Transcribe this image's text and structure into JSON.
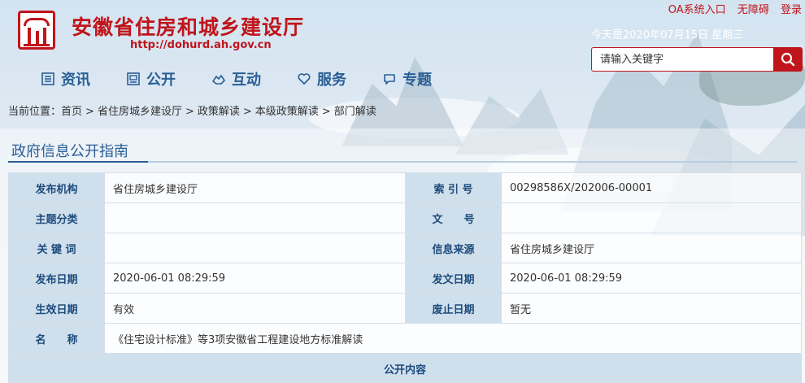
{
  "header": {
    "title": "安徽省住房和城乡建设厅",
    "url": "http://dohurd.ah.gov.cn",
    "links": [
      "OA系统入口",
      "无障碍",
      "登录"
    ],
    "date": "今天是2020年07月15日 星期三"
  },
  "search": {
    "placeholder": "请输入关键字"
  },
  "nav": [
    {
      "label": "资讯",
      "icon": "list-icon"
    },
    {
      "label": "公开",
      "icon": "board-icon"
    },
    {
      "label": "互动",
      "icon": "hands-icon"
    },
    {
      "label": "服务",
      "icon": "heart-icon"
    },
    {
      "label": "专题",
      "icon": "chat-icon"
    }
  ],
  "breadcrumb": {
    "prefix": "当前位置：",
    "items": [
      "首页",
      "省住房城乡建设厅",
      "政策解读",
      "本级政策解读",
      "部门解读"
    ]
  },
  "section": {
    "title": "政府信息公开指南"
  },
  "table": {
    "rows": [
      {
        "l1": "发布机构",
        "v1": "省住房城乡建设厅",
        "l2": "索 引 号",
        "v2": "00298586X/202006-00001"
      },
      {
        "l1": "主题分类",
        "v1": "",
        "l2": "文　　号",
        "v2": ""
      },
      {
        "l1": "关 键 词",
        "v1": "",
        "l2": "信息来源",
        "v2": "省住房城乡建设厅"
      },
      {
        "l1": "发布日期",
        "v1": "2020-06-01 08:29:59",
        "l2": "发文日期",
        "v2": "2020-06-01 08:29:59"
      },
      {
        "l1": "生效日期",
        "v1": "有效",
        "l2": "废止日期",
        "v2": "暂无"
      }
    ],
    "name_label": "名　　称",
    "name_value": "《住宅设计标准》等3项安徽省工程建设地方标准解读",
    "footer": "公开内容"
  },
  "colors": {
    "brand_red": "#c0151b",
    "nav_blue": "#2a5e95",
    "label_bg": "#cfdfec"
  }
}
